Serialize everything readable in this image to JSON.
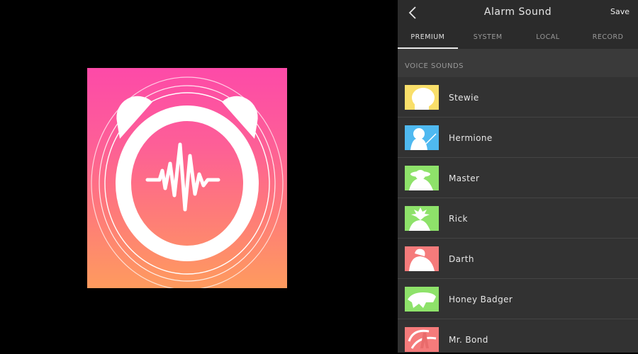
{
  "promo": {
    "name": "alarm-sound-app-icon",
    "gradient_top": "#fd4aa8",
    "gradient_bottom": "#fe9b5e"
  },
  "header": {
    "back_icon": "chevron-left-icon",
    "title": "Alarm Sound",
    "save_label": "Save"
  },
  "tabs": [
    {
      "label": "PREMIUM",
      "active": true
    },
    {
      "label": "SYSTEM",
      "active": false
    },
    {
      "label": "LOCAL",
      "active": false
    },
    {
      "label": "RECORD",
      "active": false
    }
  ],
  "section": {
    "title": "VOICE SOUNDS"
  },
  "sounds": [
    {
      "name": "Stewie",
      "color": "#f9df6a",
      "icon": "stewie-silhouette-icon"
    },
    {
      "name": "Hermione",
      "color": "#4fb9f0",
      "icon": "hermione-silhouette-icon"
    },
    {
      "name": "Master",
      "color": "#8ee26a",
      "icon": "yoda-silhouette-icon"
    },
    {
      "name": "Rick",
      "color": "#8ee26a",
      "icon": "rick-silhouette-icon"
    },
    {
      "name": "Darth",
      "color": "#f57b7b",
      "icon": "darth-silhouette-icon"
    },
    {
      "name": "Honey Badger",
      "color": "#8ee26a",
      "icon": "badger-silhouette-icon"
    },
    {
      "name": "Mr. Bond",
      "color": "#f57b7b",
      "icon": "bond-silhouette-icon"
    }
  ]
}
